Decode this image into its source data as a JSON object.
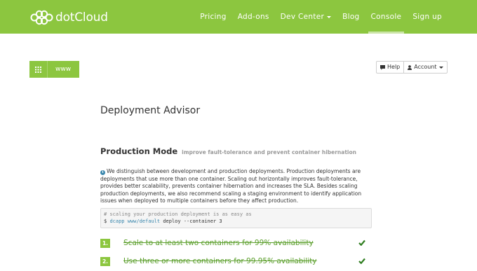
{
  "brand": {
    "name": "dotCloud"
  },
  "nav": {
    "items": [
      {
        "label": "Pricing"
      },
      {
        "label": "Add-ons"
      },
      {
        "label": "Dev Center"
      },
      {
        "label": "Blog"
      },
      {
        "label": "Console"
      },
      {
        "label": "Sign up"
      }
    ],
    "active": "Console"
  },
  "app_switcher": {
    "app_name": "www"
  },
  "toolbar": {
    "help_label": "Help",
    "account_label": "Account"
  },
  "page": {
    "title": "Deployment Advisor"
  },
  "section": {
    "title": "Production Mode",
    "subtitle": "improve fault-tolerance and prevent container hibernation",
    "info_text": "We distinguish between development and production deployments. Production deployments are deployments that use more than one container. Scaling out horizontally improves fault-tolerance, provides better scalability, prevents container hibernation and increases the SLA. Besides scaling production deployments, we also recommend scaling a staging environment to identify application issues when deployed to multiple containers before they affect production.",
    "code": {
      "comment": "# scaling your production deployment is as easy as",
      "prompt": "$",
      "command": "dcapp www/default",
      "args": "deploy --container 3"
    },
    "steps": [
      {
        "number": "1.",
        "text": "Scale to at least two containers for 99% availability",
        "done": true
      },
      {
        "number": "2.",
        "text": "Use three or more containers for 99.95% availability",
        "done": true
      }
    ]
  },
  "colors": {
    "brand_green": "#8cc63f",
    "step_text": "#5a9e2a",
    "info_blue": "#3a87ad"
  }
}
